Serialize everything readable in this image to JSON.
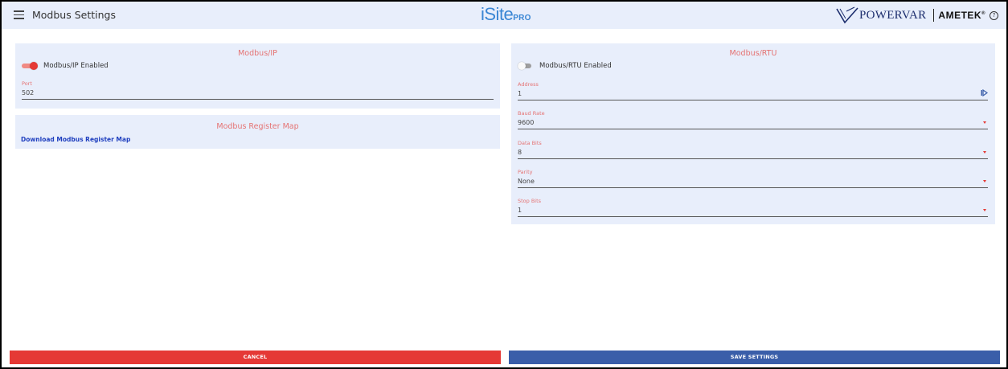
{
  "header": {
    "title": "Modbus Settings",
    "logo_isite": "iSite",
    "logo_pro": "PRO",
    "brand_powervar": "POWERVAR",
    "brand_ametek": "AMETEK",
    "brand_ametek_mark": "®",
    "help_glyph": "?"
  },
  "modbus_ip": {
    "title": "Modbus/IP",
    "toggle_label": "Modbus/IP Enabled",
    "enabled": true,
    "port_label": "Port",
    "port_value": "502"
  },
  "register_map": {
    "title": "Modbus Register Map",
    "link": "Download Modbus Register Map"
  },
  "modbus_rtu": {
    "title": "Modbus/RTU",
    "toggle_label": "Modbus/RTU Enabled",
    "enabled": false,
    "fields": [
      {
        "label": "Address",
        "value": "1"
      },
      {
        "label": "Baud Rate",
        "value": "9600"
      },
      {
        "label": "Data Bits",
        "value": "8"
      },
      {
        "label": "Parity",
        "value": "None"
      },
      {
        "label": "Stop Bits",
        "value": "1"
      }
    ]
  },
  "buttons": {
    "cancel": "CANCEL",
    "save": "SAVE SETTINGS"
  },
  "colors": {
    "accent_red": "#e53935",
    "save_blue": "#3a5ea9",
    "panel_bg": "#e8eefb",
    "label_red": "#e57373"
  },
  "icons": {
    "menu": "hamburger-menu-icon",
    "help": "help-circle-icon",
    "address_action": "input-action-icon",
    "dropdown": "dropdown-arrow-icon"
  }
}
